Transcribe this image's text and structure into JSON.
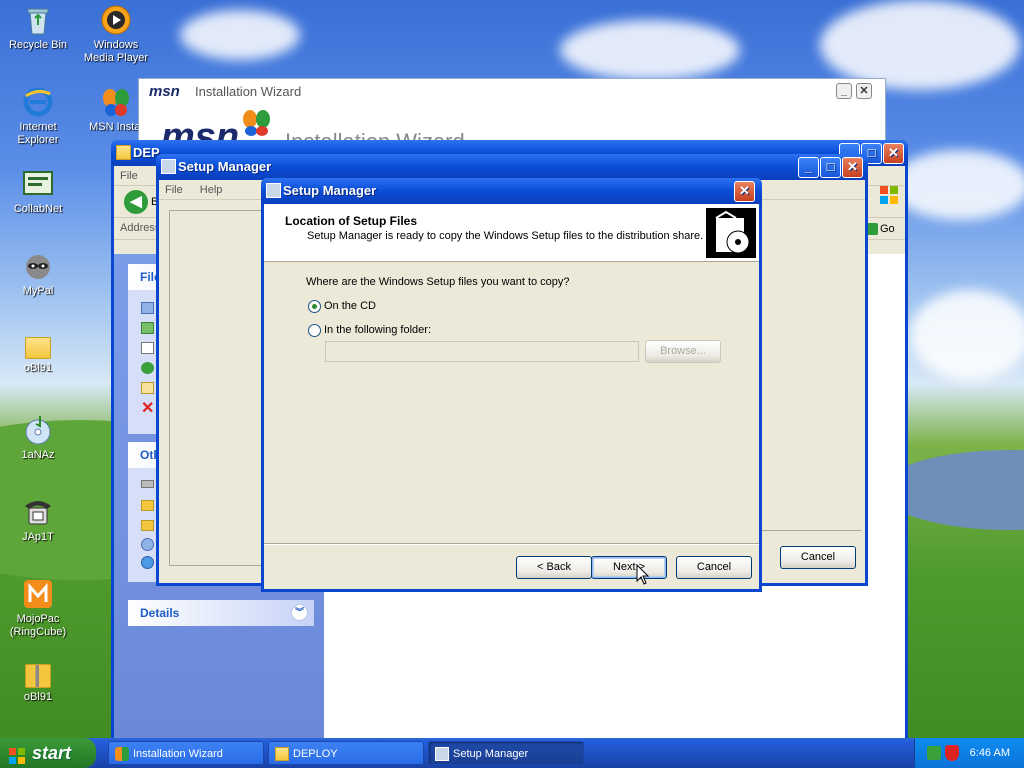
{
  "desktop": {
    "icons": [
      {
        "label": "Recycle Bin"
      },
      {
        "label": "Windows Media Player"
      },
      {
        "label": "Internet Explorer"
      },
      {
        "label": "MSN Instal"
      },
      {
        "label": "CollabNet"
      },
      {
        "label": "MyPal"
      },
      {
        "label": "oBl91"
      },
      {
        "label": "1aNAz"
      },
      {
        "label": "JAp1T"
      },
      {
        "label": "MojoPac (RingCube)"
      },
      {
        "label": "oBl91"
      }
    ]
  },
  "msn_window": {
    "logo": "msn",
    "title": "Installation Wizard",
    "banner_text": "Installation Wizard"
  },
  "explorer_window": {
    "title": "DEP",
    "menu": [
      "File"
    ],
    "back_label": "B",
    "address_label": "Address",
    "go_label": "Go",
    "task_panel_file_title": "File",
    "task_panel_other_title": "Oth",
    "details_title": "Details"
  },
  "setup_manager_window": {
    "title": "Setup Manager",
    "menu": [
      "File",
      "Help"
    ],
    "cancel_label": "Cancel"
  },
  "dialog": {
    "title": "Setup Manager",
    "header_title": "Location of Setup Files",
    "header_subtitle": "Setup Manager is ready to copy the Windows Setup files to the distribution share.",
    "question": "Where are the Windows Setup files you want to copy?",
    "option_cd": "On the CD",
    "option_folder": "In the following folder:",
    "selected_option": "On the CD",
    "folder_value": "",
    "browse_label": "Browse...",
    "back_label": "< Back",
    "next_label": "Next >",
    "cancel_label": "Cancel"
  },
  "taskbar": {
    "start_label": "start",
    "tasks": [
      {
        "label": "Installation Wizard"
      },
      {
        "label": "DEPLOY"
      },
      {
        "label": "Setup Manager"
      }
    ],
    "clock": "6:46 AM"
  },
  "colors": {
    "title_blue": "#0b4fd8",
    "dialog_face": "#ece9d8",
    "start_green": "#2d8a2d",
    "close_red": "#c6401e"
  }
}
